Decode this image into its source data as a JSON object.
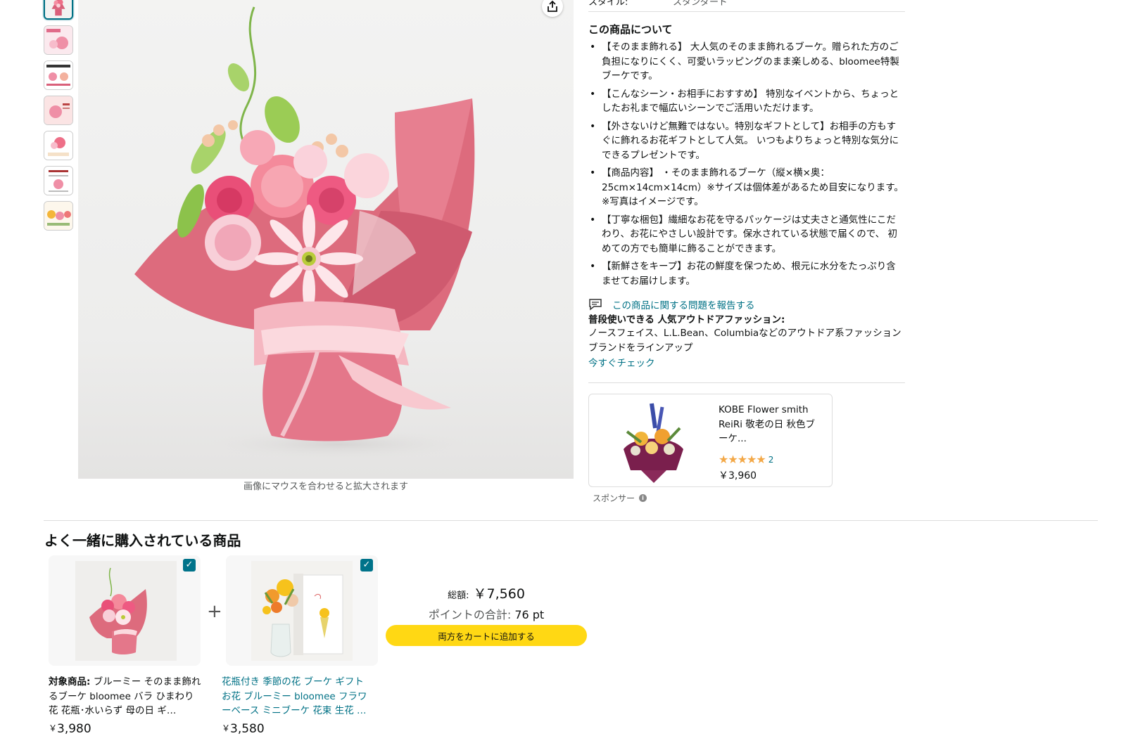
{
  "product": {
    "style_label": "スタイル:",
    "style_value": "スタンダード",
    "zoom_hint": "画像にマウスを合わせると拡大されます"
  },
  "about": {
    "title": "この商品について",
    "bullets": [
      "【そのまま飾れる】 大人気のそのまま飾れるブーケ。贈られた方のご負担になりにくく、可愛いラッピングのまま楽しめる、bloomee特製ブーケです。",
      "【こんなシーン・お相手におすすめ】 特別なイベントから、ちょっとしたお礼まで幅広いシーンでご活用いただけます。",
      "【外さないけど無難ではない。特別なギフトとして】お相手の方もすぐに飾れるお花ギフトとして人気。 いつもよりちょっと特別な気分にできるプレゼントです。",
      "【商品内容】 ・そのまま飾れるブーケ（縦×横×奥：25cm×14cm×14cm）※サイズは個体差があるため目安になります。※写真はイメージです。",
      "【丁寧な梱包】繊細なお花を守るパッケージは丈夫さと通気性にこだわり、お花にやさしい設計です。保水されている状態で届くので、 初めての方でも簡単に飾ることができます。",
      "【新鮮さをキープ】お花の鮮度を保つため、根元に水分をたっぷり含ませてお届けします。"
    ],
    "report_link": "この商品に関する問題を報告する"
  },
  "promo": {
    "title": "普段使いできる 人気アウトドアファッション:",
    "body": "ノースフェイス、L.L.Bean、Columbiaなどのアウトドア系ファッションブランドをラインアップ",
    "link": "今すぐチェック"
  },
  "sponsored": {
    "title": "KOBE Flower smith ReiRi 敬老の日 秋色ブーケ...",
    "stars": "★★★★★",
    "rating_count": "2",
    "price": "￥3,960",
    "label": "スポンサー"
  },
  "fbt": {
    "title": "よく一緒に購入されている商品",
    "plus": "+",
    "item1": {
      "label": "対象商品:",
      "name": " ブルーミー そのまま飾れるブーケ bloomee バラ ひまわり 花 花瓶･水いらず 母の日 ギ…",
      "yen": "￥",
      "price": "3,980"
    },
    "item2": {
      "name": "花瓶付き 季節の花 ブーケ ギフト お花 ブルーミー bloomee フラワーベース ミニブーケ 花束 生花 …",
      "yen": "￥",
      "price": "3,580"
    },
    "total_label": "総額:",
    "total_value": "￥7,560",
    "points_label": "ポイントの合計:",
    "points_value": "76 pt",
    "add_both_button": "両方をカートに追加する",
    "check_mark": "✓"
  },
  "colors": {
    "link": "#007185",
    "cart_button": "#ffd814",
    "check": "#00738a",
    "star": "#f3a847"
  }
}
